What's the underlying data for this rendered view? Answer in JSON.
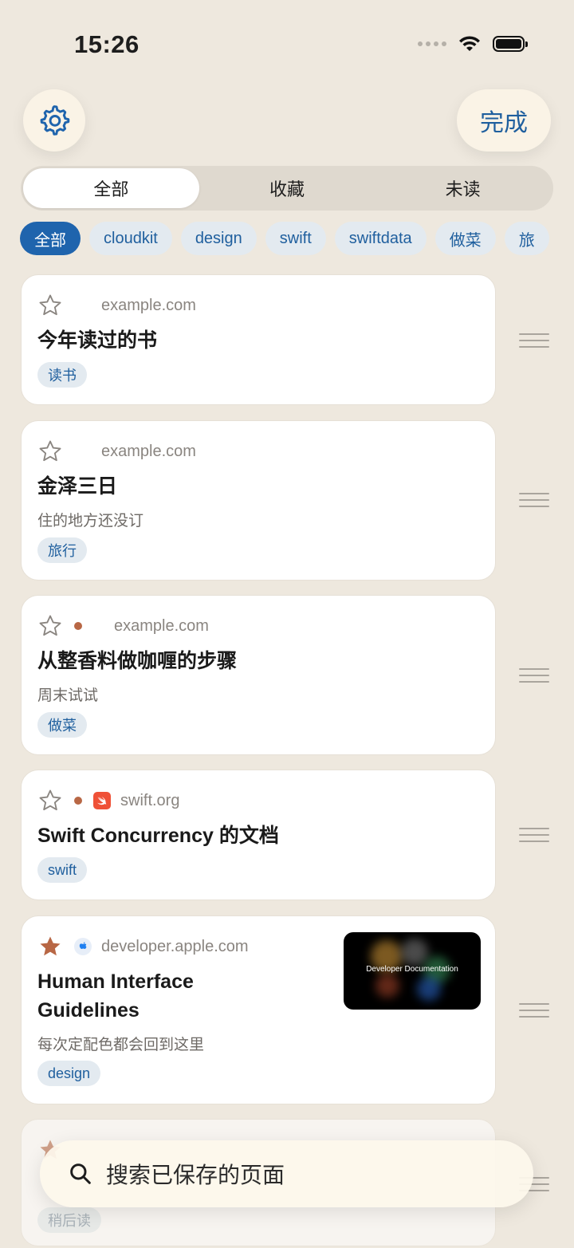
{
  "status": {
    "time": "15:26"
  },
  "header": {
    "done_label": "完成"
  },
  "filters": {
    "segments": [
      "全部",
      "收藏",
      "未读"
    ]
  },
  "tags": [
    "全部",
    "cloudkit",
    "design",
    "swift",
    "swiftdata",
    "做菜",
    "旅"
  ],
  "items": [
    {
      "starred": false,
      "unread": false,
      "domain": "example.com",
      "title": "今年读过的书",
      "note": "",
      "tag": "读书"
    },
    {
      "starred": false,
      "unread": false,
      "domain": "example.com",
      "title": "金泽三日",
      "note": "住的地方还没订",
      "tag": "旅行"
    },
    {
      "starred": false,
      "unread": true,
      "domain": "example.com",
      "title": "从整香料做咖喱的步骤",
      "note": "周末试试",
      "tag": "做菜"
    },
    {
      "starred": false,
      "unread": true,
      "site_icon": "swift-icon",
      "domain": "swift.org",
      "title": "Swift Concurrency 的文档",
      "note": "",
      "tag": "swift"
    },
    {
      "starred": true,
      "unread": false,
      "site_icon": "apple-icon",
      "domain": "developer.apple.com",
      "title_line1": "Human Interface",
      "title_line2": "Guidelines",
      "note": "每次定配色都会回到这里",
      "tag": "design",
      "thumbnail_text": "Developer Documentation"
    },
    {
      "starred": true,
      "tag": "稍后读"
    }
  ],
  "search": {
    "placeholder": "搜索已保存的页面"
  },
  "colors": {
    "accent": "#1f64ad",
    "background": "#eee8de",
    "star_filled": "#b86745",
    "unread_dot": "#b86745"
  }
}
